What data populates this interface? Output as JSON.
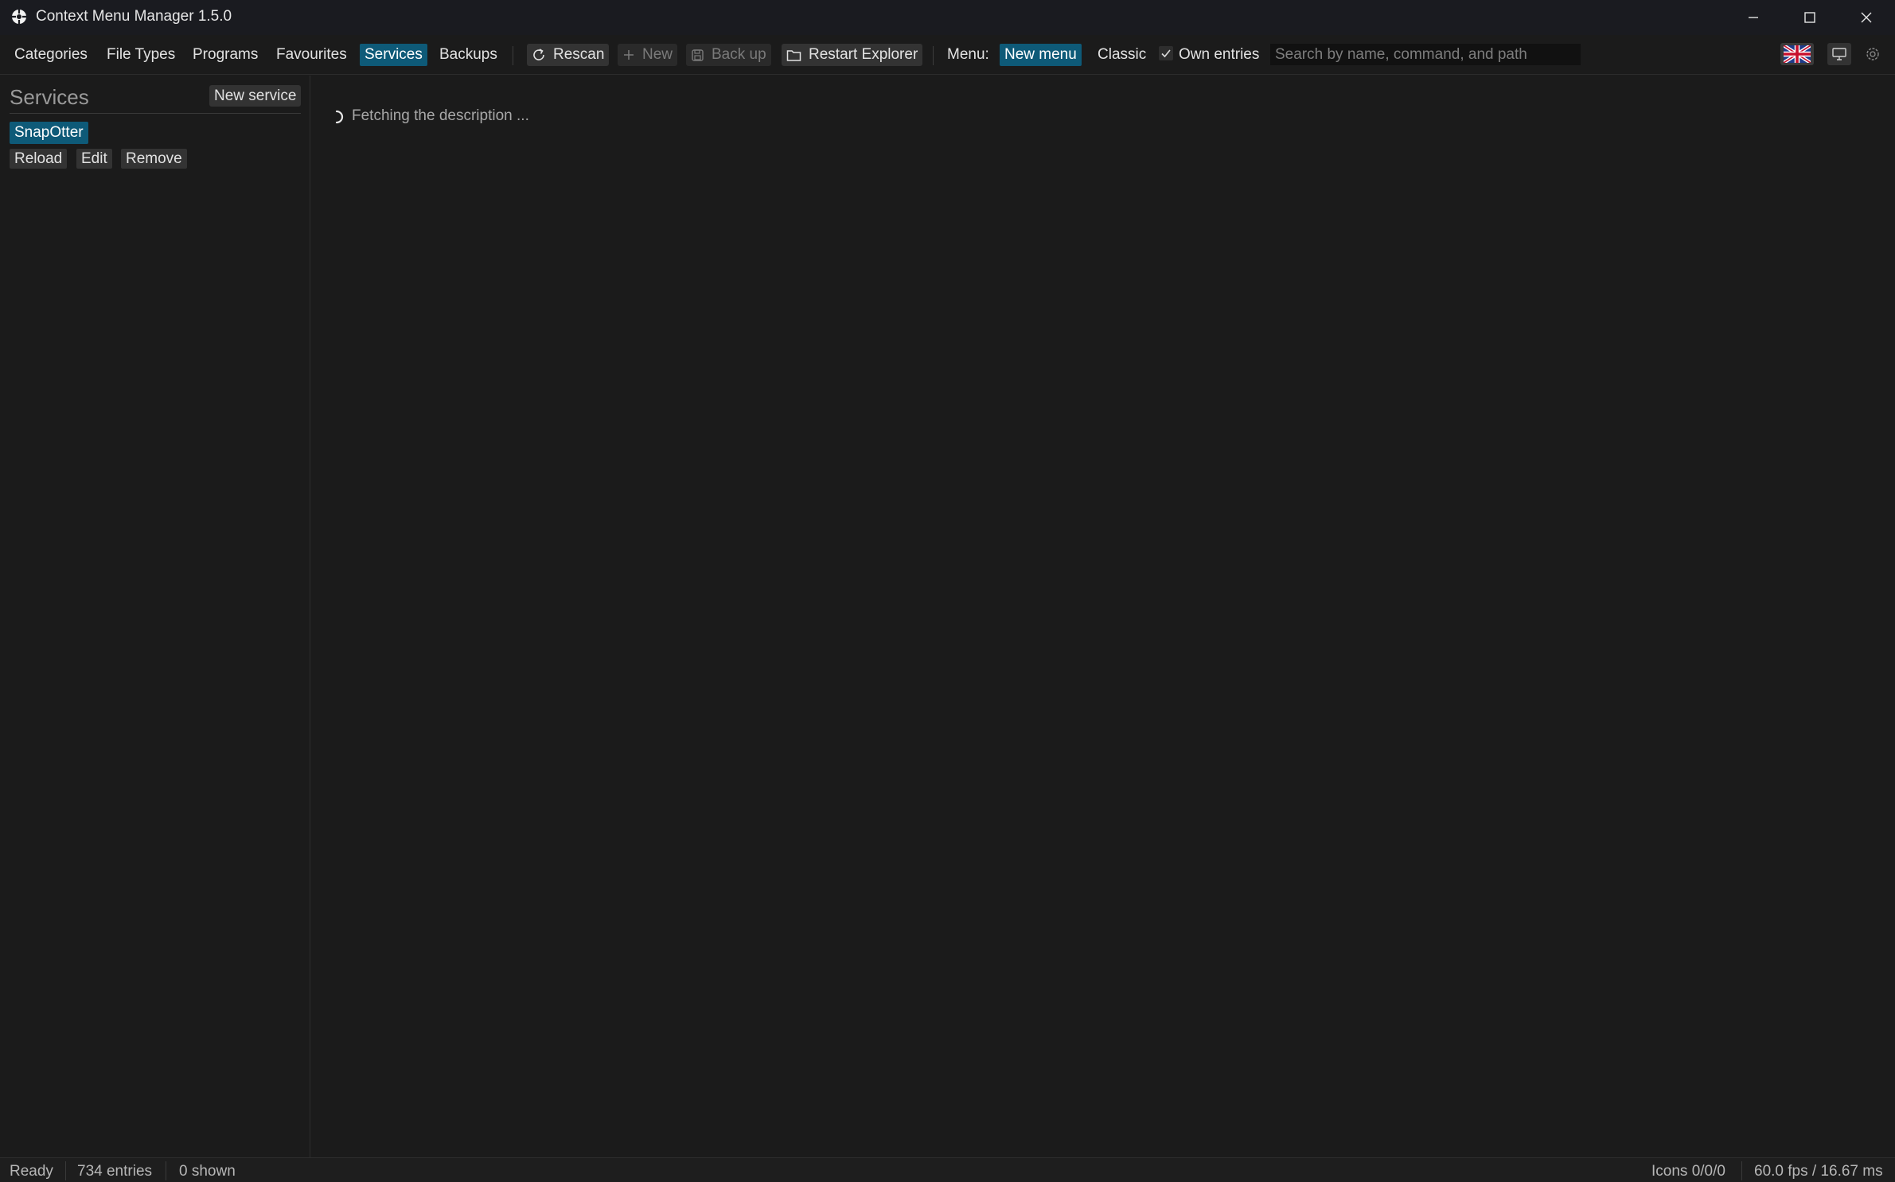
{
  "window": {
    "title": "Context Menu Manager 1.5.0"
  },
  "nav": {
    "categories": "Categories",
    "file_types": "File Types",
    "programs": "Programs",
    "favourites": "Favourites",
    "services": "Services",
    "backups": "Backups"
  },
  "toolbar": {
    "rescan": "Rescan",
    "new": "New",
    "back_up": "Back up",
    "restart_explorer": "Restart Explorer",
    "menu_label": "Menu:",
    "new_menu": "New menu",
    "classic": "Classic",
    "own_entries": "Own entries",
    "own_entries_checked": true,
    "search_placeholder": "Search by name, command, and path"
  },
  "sidebar": {
    "title": "Services",
    "new_service": "New service",
    "services": [
      {
        "label": "SnapOtter",
        "selected": true
      }
    ],
    "actions": {
      "reload": "Reload",
      "edit": "Edit",
      "remove": "Remove"
    }
  },
  "main": {
    "status_message": "Fetching the description ..."
  },
  "statusbar": {
    "state": "Ready",
    "entries": "734 entries",
    "shown": "0 shown",
    "icons": "Icons 0/0/0",
    "fps": "60.0 fps / 16.67 ms"
  },
  "colors": {
    "accent": "#0e5a78",
    "background": "#1b1b1b",
    "button": "#333333"
  }
}
